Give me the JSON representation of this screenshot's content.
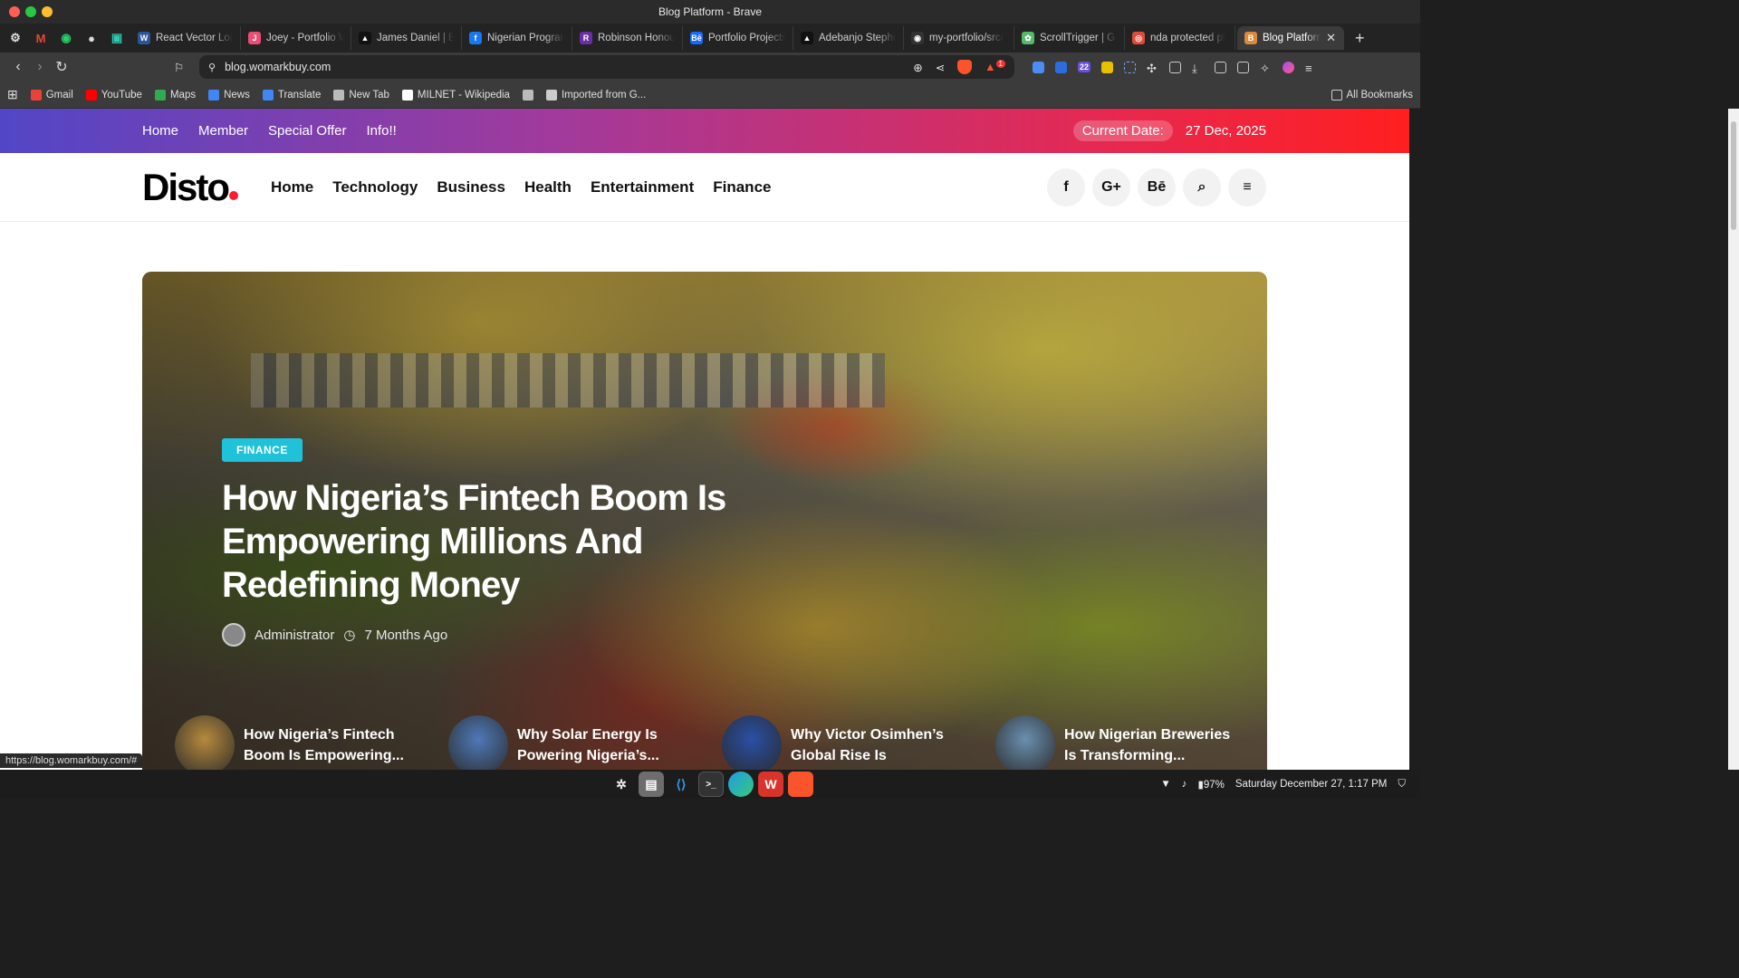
{
  "window": {
    "title": "Blog Platform - Brave"
  },
  "tabs": [
    {
      "label": "React Vector Logo",
      "color": "#2b579a",
      "glyph": "W"
    },
    {
      "label": "Joey - Portfolio W",
      "color": "#e94e77",
      "glyph": "J"
    },
    {
      "label": "James Daniel | Ba",
      "color": "#111111",
      "glyph": "▲"
    },
    {
      "label": "Nigerian Program",
      "color": "#1877f2",
      "glyph": "f"
    },
    {
      "label": "Robinson Honour",
      "color": "#6b2fa3",
      "glyph": "R"
    },
    {
      "label": "Portfolio Projects",
      "color": "#1769ff",
      "glyph": "Bē"
    },
    {
      "label": "Adebanjo Stephe",
      "color": "#111111",
      "glyph": "▲"
    },
    {
      "label": "my-portfolio/src/",
      "color": "#333333",
      "glyph": "◉"
    },
    {
      "label": "ScrollTrigger | GS",
      "color": "#55b96a",
      "glyph": "✿"
    },
    {
      "label": "nda protected pl",
      "color": "#e04a3a",
      "glyph": "◎"
    }
  ],
  "active_tab": {
    "label": "Blog Platform",
    "close": "✕"
  },
  "new_tab": "+",
  "address": {
    "url": "blog.womarkbuy.com",
    "shields_count": "1"
  },
  "extensions_badge": "22",
  "bookmarks": [
    {
      "label": "Gmail",
      "color": "#ea4335"
    },
    {
      "label": "YouTube",
      "color": "#ff0000"
    },
    {
      "label": "Maps",
      "color": "#34a853"
    },
    {
      "label": "News",
      "color": "#4285f4"
    },
    {
      "label": "Translate",
      "color": "#4285f4"
    },
    {
      "label": "New Tab",
      "color": "#bbbbbb"
    },
    {
      "label": "MILNET - Wikipedia",
      "color": "#ffffff"
    },
    {
      "label": "",
      "color": "#bbbbbb"
    },
    {
      "label": "Imported from G...",
      "color": "#cccccc"
    }
  ],
  "all_bookmarks": "All Bookmarks",
  "site": {
    "top_links": [
      "Home",
      "Member",
      "Special Offer",
      "Info!!"
    ],
    "date_label": "Current Date:",
    "date_value": "27 Dec, 2025",
    "logo": "Disto",
    "menu": [
      "Home",
      "Technology",
      "Business",
      "Health",
      "Entertainment",
      "Finance"
    ],
    "social": [
      "f",
      "G+",
      "Bē",
      "⌕",
      "≡"
    ],
    "hero": {
      "category": "FINANCE",
      "title": "How Nigeria’s Fintech Boom Is Empowering Millions And Redefining Money",
      "author": "Administrator",
      "time": "7 Months Ago"
    },
    "related": [
      {
        "title": "How Nigeria’s Fintech Boom Is Empowering...",
        "color": "#b78a3c"
      },
      {
        "title": "Why Solar Energy Is Powering Nigeria’s...",
        "color": "#4f79b8"
      },
      {
        "title": "Why Victor Osimhen’s Global Rise Is Inspiring...",
        "color": "#2a4fa6"
      },
      {
        "title": "How Nigerian Breweries Is Transforming...",
        "color": "#6a8fb0"
      }
    ]
  },
  "status_url": "https://blog.womarkbuy.com/#",
  "system": {
    "battery": "97%",
    "clock": "Saturday December 27, 1:17 PM"
  }
}
